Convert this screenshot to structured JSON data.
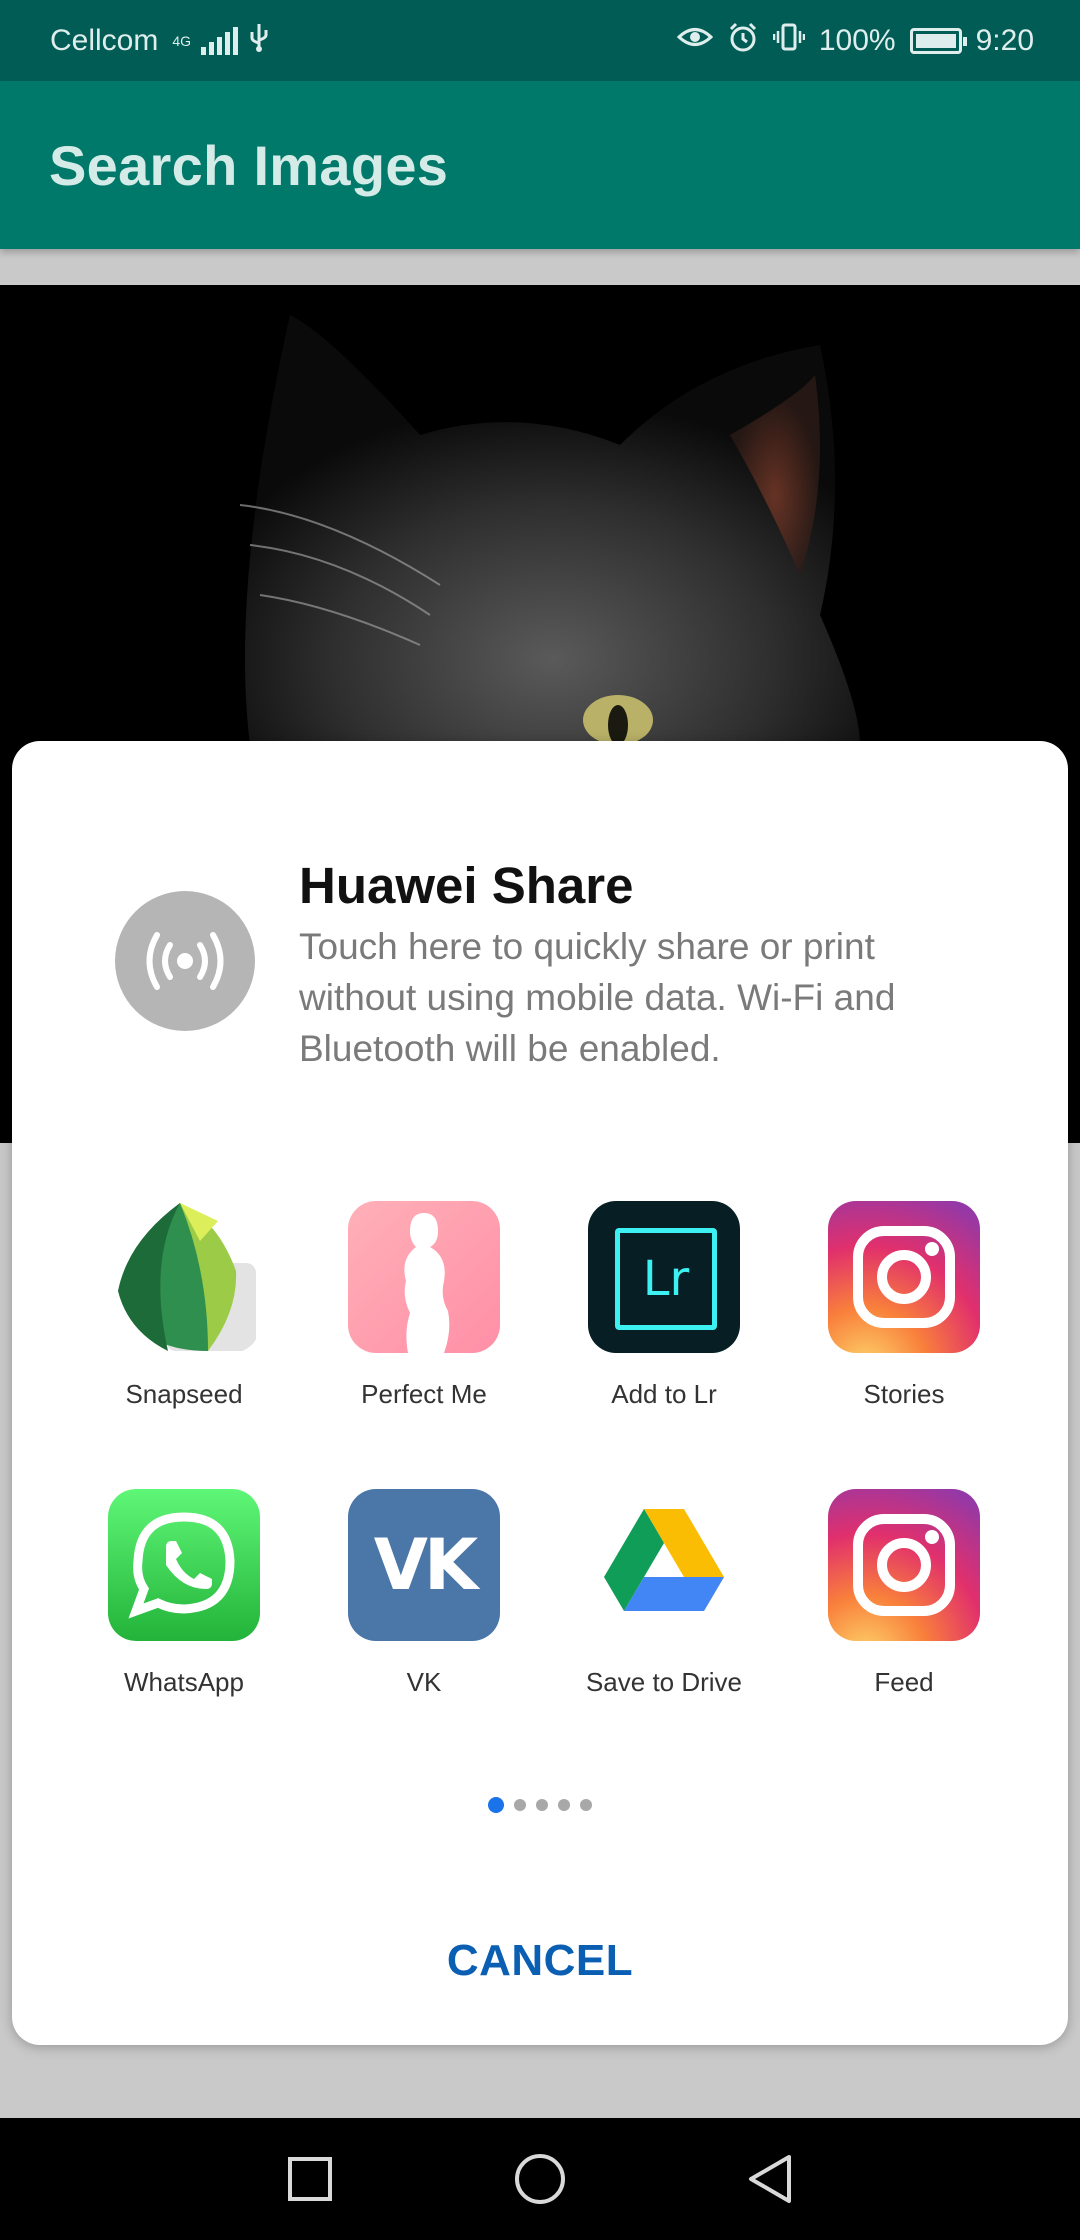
{
  "status_bar": {
    "carrier": "Cellcom",
    "network": "4G",
    "battery_percent": "100%",
    "battery_level": 1.0,
    "time": "9:20",
    "icons": [
      "signal-icon",
      "usb-icon",
      "eye-comfort-icon",
      "alarm-icon",
      "vibrate-icon",
      "battery-icon"
    ]
  },
  "app_bar": {
    "title": "Search Images"
  },
  "share_sheet": {
    "huawei_share": {
      "title": "Huawei Share",
      "description": "Touch here to quickly share or print without using mobile data. Wi-Fi and Bluetooth will be enabled.",
      "icon": "broadcast-icon"
    },
    "apps": [
      [
        {
          "label": "Snapseed",
          "icon": "snapseed-icon"
        },
        {
          "label": "Perfect Me",
          "icon": "perfect-me-icon"
        },
        {
          "label": "Add to Lr",
          "icon": "lightroom-icon"
        },
        {
          "label": "Stories",
          "icon": "instagram-icon"
        }
      ],
      [
        {
          "label": "WhatsApp",
          "icon": "whatsapp-icon"
        },
        {
          "label": "VK",
          "icon": "vk-icon"
        },
        {
          "label": "Save to Drive",
          "icon": "google-drive-icon"
        },
        {
          "label": "Feed",
          "icon": "instagram-icon"
        }
      ]
    ],
    "lr_text": "Lr",
    "vk_text": "VK",
    "page_count": 5,
    "current_page": 1,
    "cancel_label": "CANCEL"
  },
  "colors": {
    "status_bar": "#005c55",
    "app_bar": "#00796b",
    "cancel": "#0b5fb3",
    "active_dot": "#1a73e8"
  }
}
